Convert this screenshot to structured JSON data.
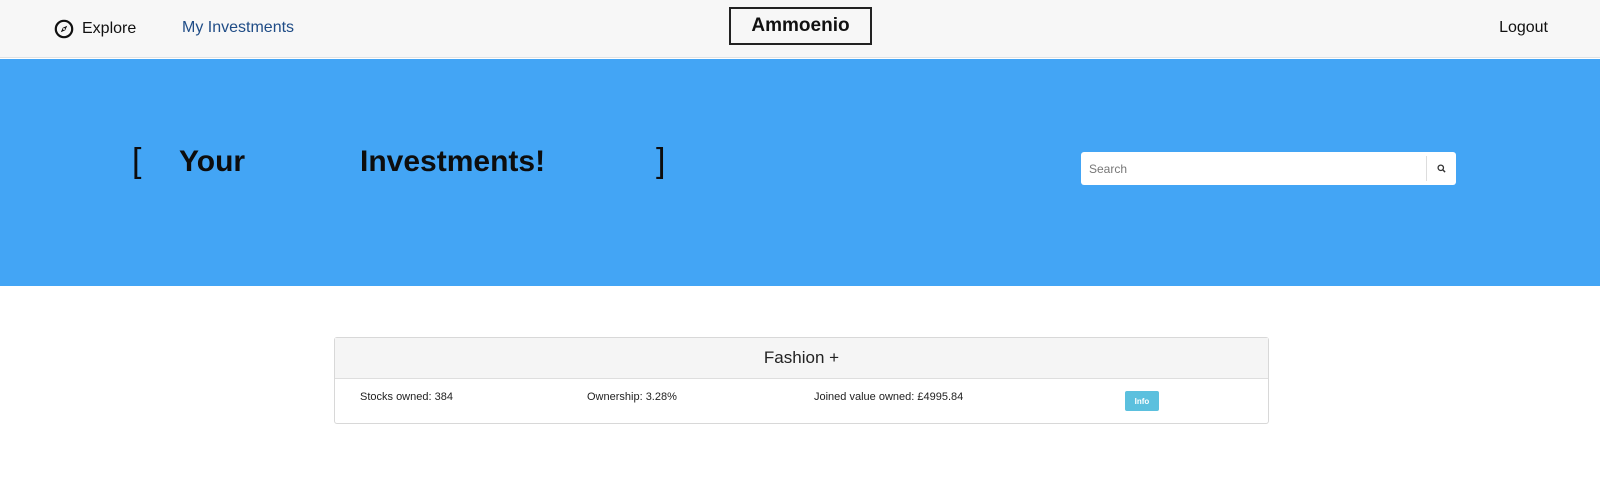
{
  "navbar": {
    "explore_label": "Explore",
    "explore_icon": "compass-icon",
    "my_investments_label": "My Investments",
    "brand": "Ammoenio",
    "logout_label": "Logout"
  },
  "hero": {
    "bracket_open": "[",
    "word_1": "Your",
    "word_2": "Investments!",
    "bracket_close": "]",
    "background_color": "#43a5f5"
  },
  "search": {
    "placeholder": "Search",
    "value": "",
    "icon": "search-icon"
  },
  "investments": [
    {
      "title": "Fashion +",
      "stocks_owned": "Stocks owned: 384",
      "ownership": "Ownership: 3.28%",
      "joined_value": "Joined value owned: £4995.84",
      "info_label": "Info",
      "info_color": "#5bc0de"
    }
  ]
}
